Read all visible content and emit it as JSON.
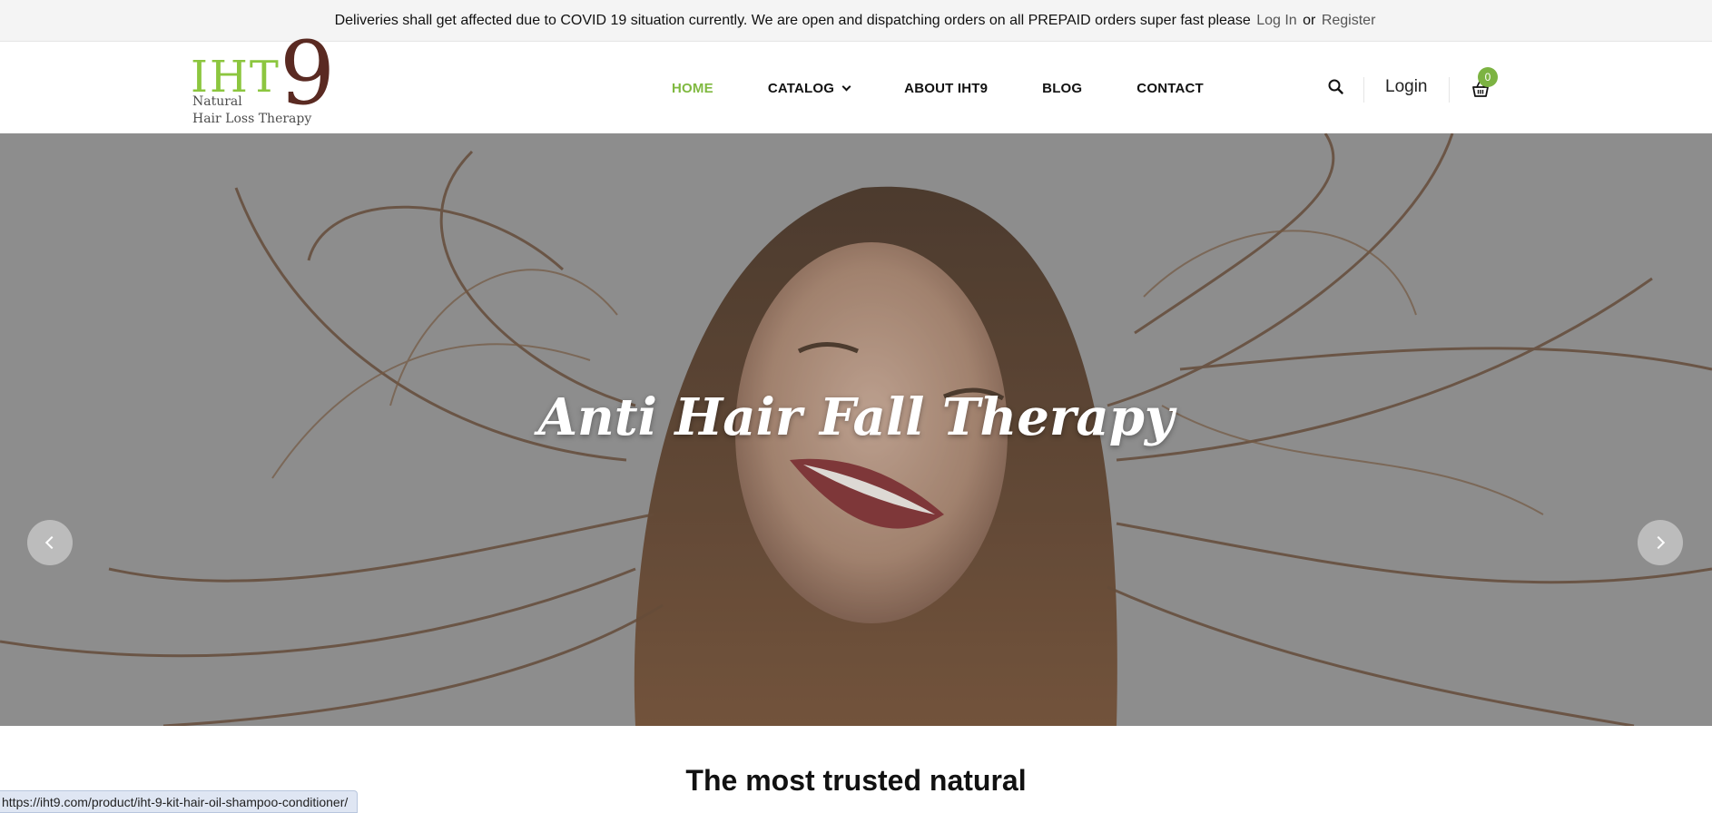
{
  "announcement": {
    "text": "Deliveries shall get affected due to COVID 19 situation currently. We are open and dispatching orders on all PREPAID orders super fast please",
    "login_link": "Log In",
    "or_text": "or",
    "register_link": "Register"
  },
  "logo": {
    "brand": "IHT",
    "digit": "9",
    "line1": "Natural",
    "line2": "Hair Loss Therapy"
  },
  "nav": {
    "items": [
      {
        "label": "HOME",
        "active": true
      },
      {
        "label": "CATALOG",
        "has_dropdown": true
      },
      {
        "label": "ABOUT IHT9"
      },
      {
        "label": "BLOG"
      },
      {
        "label": "CONTACT"
      }
    ]
  },
  "header_actions": {
    "search_icon": "search-icon",
    "login_label": "Login",
    "cart_icon": "basket-icon",
    "cart_count": "0"
  },
  "hero": {
    "title": "Anti Hair Fall Therapy",
    "prev_icon": "chevron-left-icon",
    "next_icon": "chevron-right-icon"
  },
  "section": {
    "title": "The most trusted natural"
  },
  "status_bar": {
    "url": "https://iht9.com/product/iht-9-kit-hair-oil-shampoo-conditioner/"
  },
  "colors": {
    "accent_green": "#80b941",
    "logo_brown": "#5a2a22",
    "hero_overlay": "#8d8d8d"
  }
}
